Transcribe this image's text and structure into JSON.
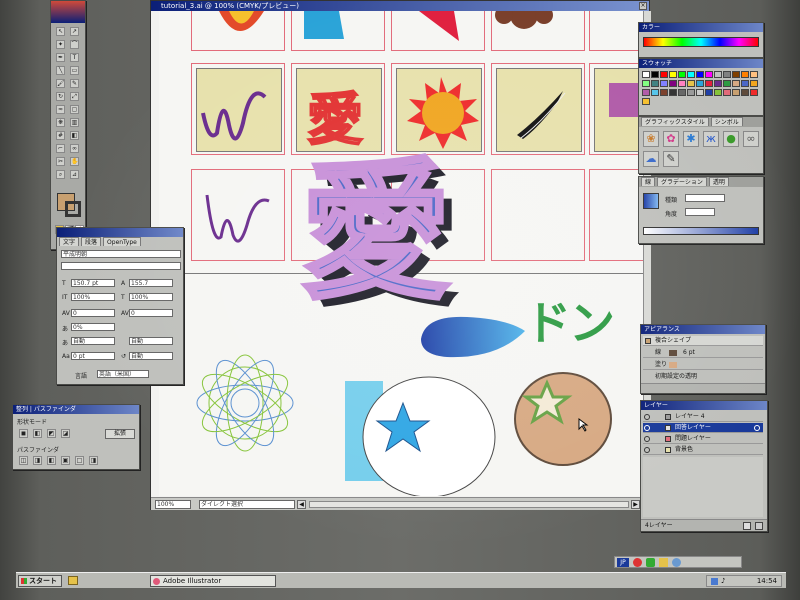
{
  "window": {
    "title": "tutorial_3.ai @ 100% (CMYK/プレビュー)"
  },
  "kanji": "愛",
  "w_glyph": "W",
  "katakana": "ドン",
  "status": {
    "zoom": "100%",
    "tool": "ダイレクト選択"
  },
  "char_panel": {
    "tabs": [
      "文字",
      "段落",
      "OpenType"
    ],
    "font": "平成明朝",
    "size": "150.7 pt",
    "leading": "155.7",
    "hscale": "100%",
    "vscale": "100%",
    "tracking": "0",
    "kerning": "0",
    "tsume": "0%",
    "baseline": "0 pt",
    "auto_label": "自動",
    "lang_label": "言語",
    "lang": "英語（米国）"
  },
  "pathfinder": {
    "title": "整列",
    "tab": "パスファインダ",
    "shape_mode": "形状モード",
    "expand": "拡張",
    "pathfinder_label": "パスファインダ"
  },
  "color_panel": {
    "title": "カラー"
  },
  "swatch_panel": {
    "title": "スウォッチ"
  },
  "graphic_style": {
    "title": "グラフィックスタイル",
    "tab2": "シンボル"
  },
  "gradient_panel": {
    "tab1": "線",
    "tab2": "グラデーション",
    "tab3": "透明",
    "kind_label": "種類",
    "angle_label": "角度"
  },
  "appearance": {
    "title": "アピアランス",
    "object": "複合シェイプ",
    "stroke_label": "線",
    "stroke_value": "6 pt",
    "fill_label": "塗り",
    "default_label": "初期設定の透明"
  },
  "layers": {
    "title": "レイヤー",
    "items": [
      "レイヤー 4",
      "回答レイヤー",
      "問題レイヤー",
      "背景色"
    ],
    "count": "4レイヤー"
  },
  "taskbar": {
    "start": "スタート",
    "app": "Adobe Illustrator",
    "clock": "14:54",
    "ime": "JP"
  },
  "colors": {
    "title_bar": "#0b1f78",
    "kanji_fill": "#4a67c7",
    "artboard_cell": "#e7e1ac",
    "guide_line": "#e26b7a"
  }
}
